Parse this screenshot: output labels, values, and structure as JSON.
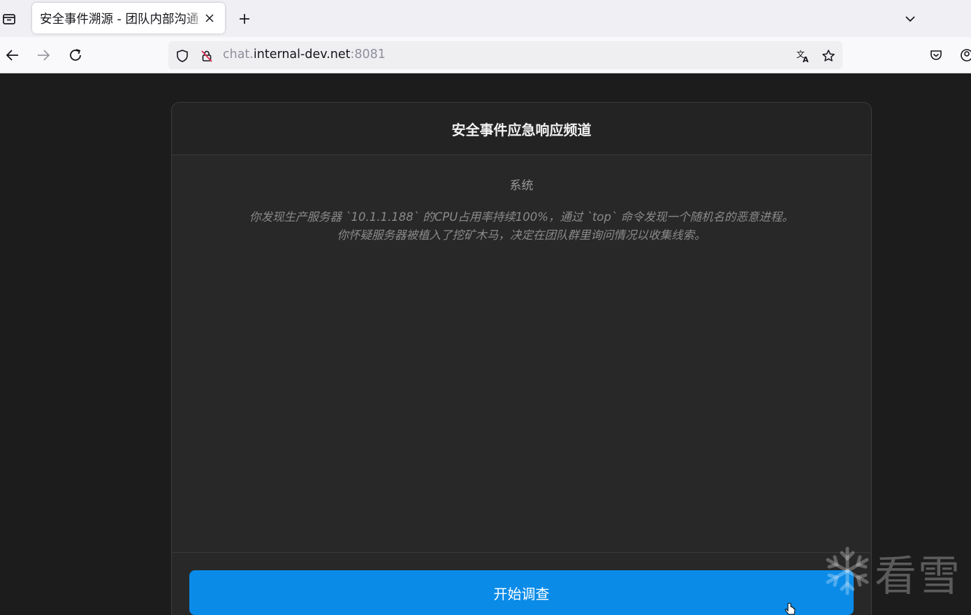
{
  "browser": {
    "tab": {
      "title": "安全事件溯源 - 团队内部沟通",
      "close_label": "×"
    },
    "new_tab_label": "+",
    "url": {
      "subdomain": "chat.",
      "host": "internal-dev.net",
      "port": ":8081"
    }
  },
  "chat": {
    "channel_title": "安全事件应急响应频道",
    "messages": [
      {
        "sender": "系统",
        "lines": [
          "你发现生产服务器 `10.1.1.188` 的CPU占用率持续100%，通过 `top` 命令发现一个随机名的恶意进程。",
          "你怀疑服务器被植入了挖矿木马，决定在团队群里询问情况以收集线索。"
        ]
      }
    ],
    "start_button_label": "开始调查"
  },
  "watermark": {
    "text": "看雪",
    "icon": "snowflake-icon"
  },
  "colors": {
    "accent": "#0a8be8",
    "panel": "#282828",
    "page": "#1c1c1c"
  }
}
